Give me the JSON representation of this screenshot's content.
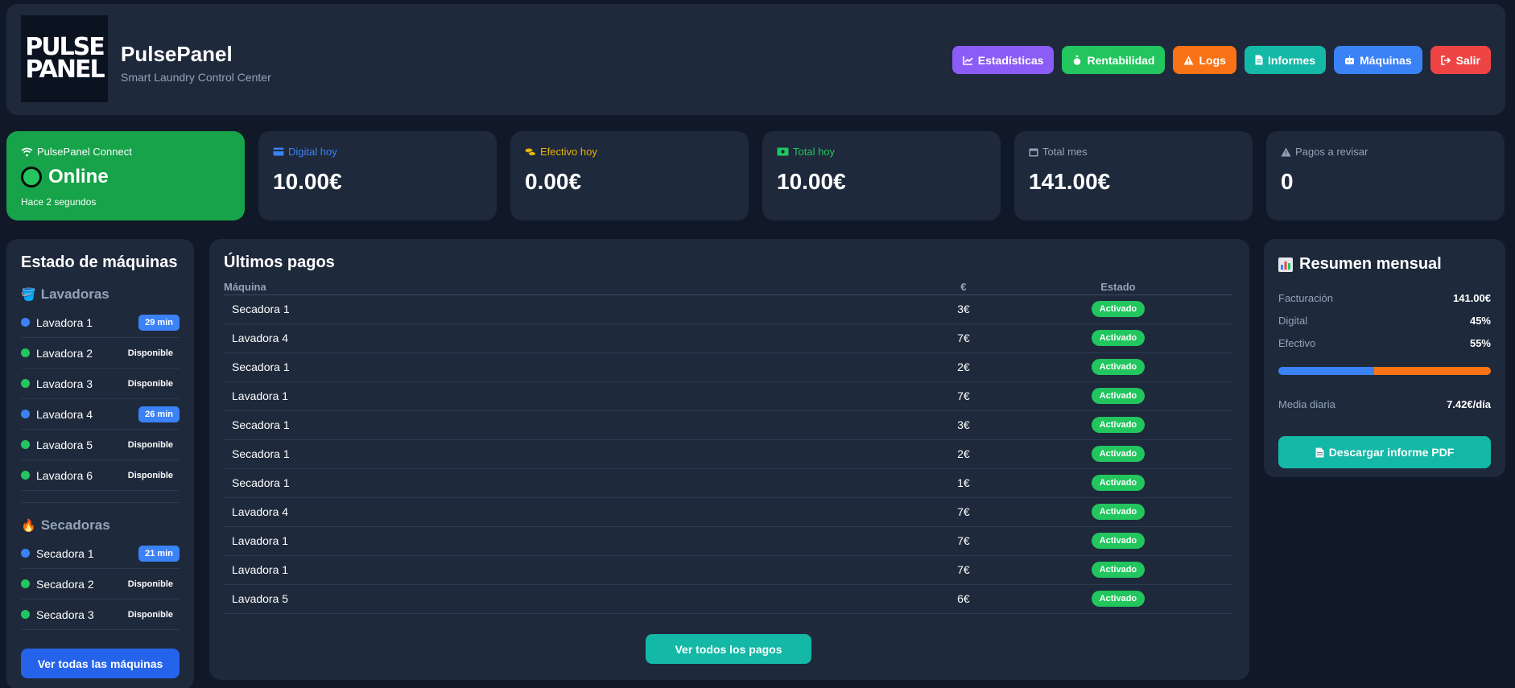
{
  "colors": {
    "background": "#111827",
    "card": "#1e293b",
    "connect": "#16a34a",
    "digital": "#3b82f6",
    "cash": "#f97316",
    "success": "#22c55e",
    "teal": "#14b8a6"
  },
  "header": {
    "logo_line1": "PULSE",
    "logo_line2": "PANEL",
    "title": "PulsePanel",
    "subtitle": "Smart Laundry Control Center",
    "nav": [
      {
        "label": "Estadísticas",
        "icon": "chart-line-icon",
        "color": "#8b5cf6"
      },
      {
        "label": "Rentabilidad",
        "icon": "money-bag-icon",
        "color": "#22c55e"
      },
      {
        "label": "Logs",
        "icon": "warning-icon",
        "color": "#f97316"
      },
      {
        "label": "Informes",
        "icon": "file-icon",
        "color": "#14b8a6"
      },
      {
        "label": "Máquinas",
        "icon": "robot-icon",
        "color": "#3b82f6"
      },
      {
        "label": "Salir",
        "icon": "sign-out-icon",
        "color": "#ef4444"
      }
    ]
  },
  "stats": {
    "connect": {
      "label": "PulsePanel Connect",
      "status": "Online",
      "time": "Hace 2 segundos"
    },
    "digital": {
      "label": "Digital hoy",
      "value": "10.00€",
      "color": "#3b82f6"
    },
    "cash": {
      "label": "Efectivo hoy",
      "value": "0.00€",
      "color": "#eab308"
    },
    "total": {
      "label": "Total hoy",
      "value": "10.00€",
      "color": "#22c55e"
    },
    "month": {
      "label": "Total mes",
      "value": "141.00€",
      "color": "#94a3b8"
    },
    "review": {
      "label": "Pagos a revisar",
      "value": "0",
      "color": "#94a3b8"
    }
  },
  "machines": {
    "title": "Estado de máquinas",
    "washers_title": "Lavadoras",
    "washers": [
      {
        "name": "Lavadora 1",
        "status": "29 min",
        "busy": true
      },
      {
        "name": "Lavadora 2",
        "status": "Disponible",
        "busy": false
      },
      {
        "name": "Lavadora 3",
        "status": "Disponible",
        "busy": false
      },
      {
        "name": "Lavadora 4",
        "status": "26 min",
        "busy": true
      },
      {
        "name": "Lavadora 5",
        "status": "Disponible",
        "busy": false
      },
      {
        "name": "Lavadora 6",
        "status": "Disponible",
        "busy": false
      }
    ],
    "dryers_title": "Secadoras",
    "dryers": [
      {
        "name": "Secadora 1",
        "status": "21 min",
        "busy": true
      },
      {
        "name": "Secadora 2",
        "status": "Disponible",
        "busy": false
      },
      {
        "name": "Secadora 3",
        "status": "Disponible",
        "busy": false
      }
    ],
    "view_all": "Ver todas las máquinas"
  },
  "payments": {
    "title": "Últimos pagos",
    "headers": {
      "machine": "Máquina",
      "amount": "€",
      "state": "Estado"
    },
    "rows": [
      {
        "machine": "Secadora 1",
        "amount": "3€",
        "state": "Activado"
      },
      {
        "machine": "Lavadora 4",
        "amount": "7€",
        "state": "Activado"
      },
      {
        "machine": "Secadora 1",
        "amount": "2€",
        "state": "Activado"
      },
      {
        "machine": "Lavadora 1",
        "amount": "7€",
        "state": "Activado"
      },
      {
        "machine": "Secadora 1",
        "amount": "3€",
        "state": "Activado"
      },
      {
        "machine": "Secadora 1",
        "amount": "2€",
        "state": "Activado"
      },
      {
        "machine": "Secadora 1",
        "amount": "1€",
        "state": "Activado"
      },
      {
        "machine": "Lavadora 4",
        "amount": "7€",
        "state": "Activado"
      },
      {
        "machine": "Lavadora 1",
        "amount": "7€",
        "state": "Activado"
      },
      {
        "machine": "Lavadora 1",
        "amount": "7€",
        "state": "Activado"
      },
      {
        "machine": "Lavadora 5",
        "amount": "6€",
        "state": "Activado"
      }
    ],
    "view_all": "Ver todos los pagos"
  },
  "summary": {
    "title": "Resumen mensual",
    "billing_label": "Facturación",
    "billing_value": "141.00€",
    "digital_label": "Digital",
    "digital_value": "45%",
    "cash_label": "Efectivo",
    "cash_value": "55%",
    "digital_fraction": 0.45,
    "avg_label": "Media diaria",
    "avg_value": "7.42€/día",
    "pdf_button": "Descargar informe PDF"
  }
}
